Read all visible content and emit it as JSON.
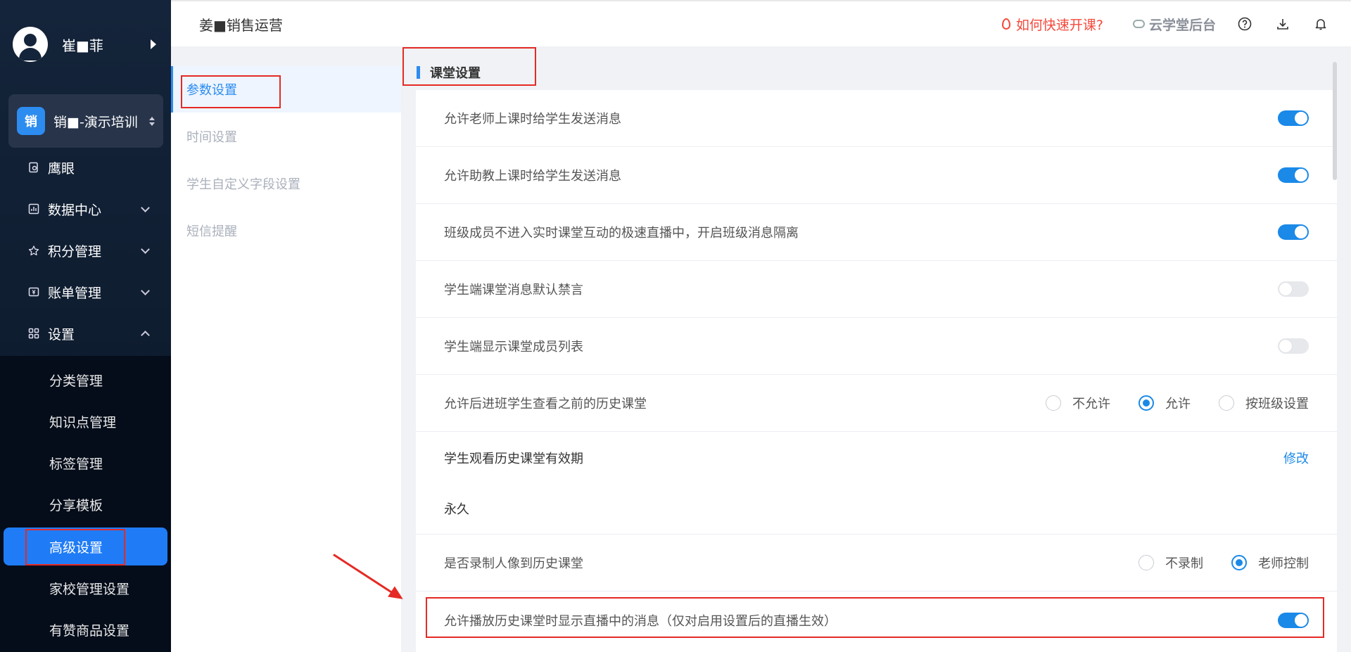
{
  "sidebar": {
    "user_name": "崔■菲",
    "org_badge": "销",
    "org_name": "销■-演示培训",
    "nav": [
      {
        "label": "鹰眼"
      },
      {
        "label": "数据中心"
      },
      {
        "label": "积分管理"
      },
      {
        "label": "账单管理"
      },
      {
        "label": "设置"
      }
    ],
    "sub_items": [
      {
        "label": "分类管理"
      },
      {
        "label": "知识点管理"
      },
      {
        "label": "标签管理"
      },
      {
        "label": "分享模板"
      },
      {
        "label": "高级设置"
      },
      {
        "label": "家校管理设置"
      },
      {
        "label": "有赞商品设置"
      }
    ]
  },
  "header": {
    "title": "姜■销售运营",
    "quick_start": "如何快速开课?",
    "backend": "云学堂后台"
  },
  "submenu": [
    {
      "label": "参数设置"
    },
    {
      "label": "时间设置"
    },
    {
      "label": "学生自定义字段设置"
    },
    {
      "label": "短信提醒"
    }
  ],
  "section_title": "课堂设置",
  "settings": [
    {
      "label": "允许老师上课时给学生发送消息",
      "toggle": "on"
    },
    {
      "label": "允许助教上课时给学生发送消息",
      "toggle": "on"
    },
    {
      "label": "班级成员不进入实时课堂互动的极速直播中，开启班级消息隔离",
      "toggle": "on"
    },
    {
      "label": "学生端课堂消息默认禁言",
      "toggle": "off"
    },
    {
      "label": "学生端显示课堂成员列表",
      "toggle": "off"
    },
    {
      "label": "允许后进班学生查看之前的历史课堂",
      "options": [
        "不允许",
        "允许",
        "按班级设置"
      ],
      "selected": "允许"
    },
    {
      "label": "学生观看历史课堂有效期",
      "link": "修改",
      "value": "永久"
    },
    {
      "label": "是否录制人像到历史课堂",
      "options": [
        "不录制",
        "老师控制"
      ],
      "selected": "老师控制"
    },
    {
      "label": "允许播放历史课堂时显示直播中的消息（仅对启用设置后的直播生效）",
      "toggle": "on"
    }
  ],
  "colors": {
    "accent": "#1a89e8",
    "sidebar_active": "#1f7cf6",
    "annotation": "#e52a25",
    "warning_link": "#f5483b"
  }
}
